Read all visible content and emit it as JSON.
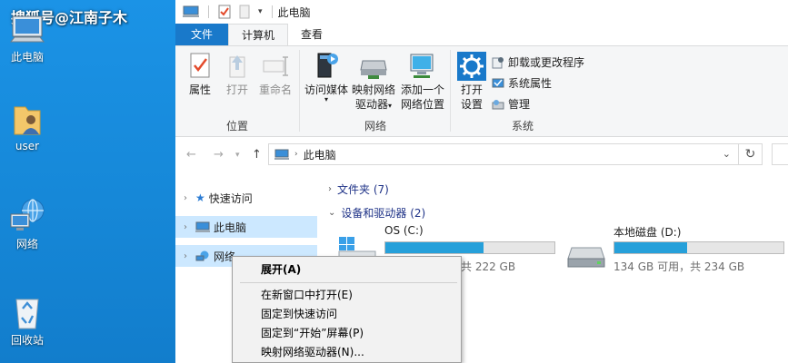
{
  "desktop": {
    "watermark": "搜狐号@江南子木",
    "icons": [
      {
        "label": "此电脑",
        "icon": "computer-icon"
      },
      {
        "label": "user",
        "icon": "user-folder-icon"
      },
      {
        "label": "网络",
        "icon": "network-globe-icon"
      },
      {
        "label": "回收站",
        "icon": "recycle-bin-icon"
      }
    ]
  },
  "window": {
    "title": "此电脑",
    "tabs": {
      "file": "文件",
      "computer": "计算机",
      "view": "查看"
    }
  },
  "ribbon": {
    "location": {
      "name": "位置",
      "buttons": [
        {
          "label": "属性",
          "icon": "properties-icon"
        },
        {
          "label": "打开",
          "icon": "open-icon"
        },
        {
          "label": "重命名",
          "icon": "rename-icon"
        }
      ]
    },
    "network": {
      "name": "网络",
      "buttons": [
        {
          "label": "访问媒体",
          "icon": "media-icon"
        },
        {
          "label": "映射网络",
          "label2": "驱动器",
          "icon": "map-drive-icon"
        },
        {
          "label": "添加一个",
          "label2": "网络位置",
          "icon": "network-location-icon"
        }
      ]
    },
    "system": {
      "name": "系统",
      "open_settings": {
        "label": "打开",
        "label2": "设置",
        "icon": "settings-gear-icon"
      },
      "items": [
        {
          "label": "卸载或更改程序",
          "icon": "uninstall-icon"
        },
        {
          "label": "系统属性",
          "icon": "system-properties-icon"
        },
        {
          "label": "管理",
          "icon": "manage-icon"
        }
      ]
    }
  },
  "address": {
    "path": "此电脑",
    "icon": "computer-icon"
  },
  "navpane": {
    "items": [
      {
        "label": "快速访问",
        "icon": "star-icon",
        "selected": false
      },
      {
        "label": "此电脑",
        "icon": "computer-icon",
        "selected": true
      },
      {
        "label": "网络",
        "icon": "network-icon",
        "selected": false
      }
    ]
  },
  "content": {
    "folders_section": "文件夹 (7)",
    "drives_section": "设备和驱动器 (2)",
    "drives": [
      {
        "name": "OS (C:)",
        "size_text": "共 222 GB",
        "used_fraction": 0.58,
        "icon": "windows-drive-icon"
      },
      {
        "name": "本地磁盘 (D:)",
        "size_text": "134 GB 可用，共 234 GB",
        "used_fraction": 0.43,
        "icon": "hard-drive-icon"
      }
    ]
  },
  "context_menu": {
    "items": [
      {
        "label": "展开(A)",
        "bold": true
      },
      {
        "separator": true
      },
      {
        "label": "在新窗口中打开(E)"
      },
      {
        "label": "固定到快速访问"
      },
      {
        "label": "固定到“开始”屏幕(P)"
      },
      {
        "label": "映射网络驱动器(N)..."
      }
    ]
  },
  "colors": {
    "accent": "#1979ca",
    "selection": "#cce8ff",
    "drive_bar": "#26a0da",
    "desktop": "#1688d8"
  }
}
